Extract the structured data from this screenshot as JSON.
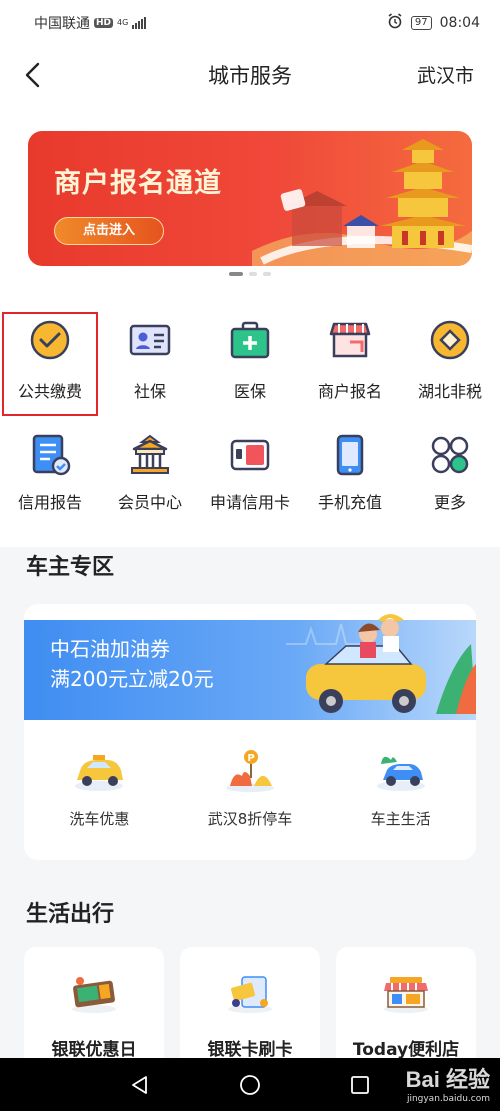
{
  "status_bar": {
    "carrier": "中国联通",
    "hd": "HD",
    "network": "4G",
    "battery": "97",
    "time": "08:04"
  },
  "header": {
    "title": "城市服务",
    "city": "武汉市"
  },
  "banner": {
    "title": "商户报名通道",
    "button_label": "点击进入",
    "slide_count": 3,
    "active_slide": 1
  },
  "services": {
    "row1": [
      {
        "label": "公共缴费",
        "icon": "check-circle-icon",
        "color": "#f7b731"
      },
      {
        "label": "社保",
        "icon": "id-card-icon",
        "color": "#4a5cd6"
      },
      {
        "label": "医保",
        "icon": "medical-kit-icon",
        "color": "#2dc48c"
      },
      {
        "label": "商户报名",
        "icon": "shop-icon",
        "color": "#f06b6b"
      },
      {
        "label": "湖北非税",
        "icon": "diamond-coin-icon",
        "color": "#f7b731"
      }
    ],
    "row2": [
      {
        "label": "信用报告",
        "icon": "report-icon",
        "color": "#3d8ef5"
      },
      {
        "label": "会员中心",
        "icon": "pavilion-icon",
        "color": "#f5a623"
      },
      {
        "label": "申请信用卡",
        "icon": "credit-card-icon",
        "color": "#f2545b"
      },
      {
        "label": "手机充值",
        "icon": "phone-icon",
        "color": "#3d8ef5"
      },
      {
        "label": "更多",
        "icon": "grid-more-icon",
        "color": "#2dc48c"
      }
    ]
  },
  "car_section": {
    "title": "车主专区",
    "banner_line1": "中石油加油券",
    "banner_line2": "满200元立减20元",
    "items": [
      {
        "label": "洗车优惠",
        "icon": "taxi-car-icon"
      },
      {
        "label": "武汉8折停车",
        "icon": "parking-icon"
      },
      {
        "label": "车主生活",
        "icon": "blue-car-icon"
      }
    ]
  },
  "life_section": {
    "title": "生活出行",
    "cards": [
      {
        "label": "银联优惠日",
        "icon": "coupon-icon"
      },
      {
        "label": "银联卡刷卡",
        "icon": "card-swipe-icon"
      },
      {
        "label": "Today便利店",
        "icon": "store-icon"
      }
    ]
  },
  "watermark": {
    "logo": "Bai 经验",
    "url": "jingyan.baidu.com"
  },
  "colors": {
    "highlight_border": "#e3242b",
    "banner_red": "#e83a2c",
    "car_banner_blue": "#3f8df2"
  }
}
